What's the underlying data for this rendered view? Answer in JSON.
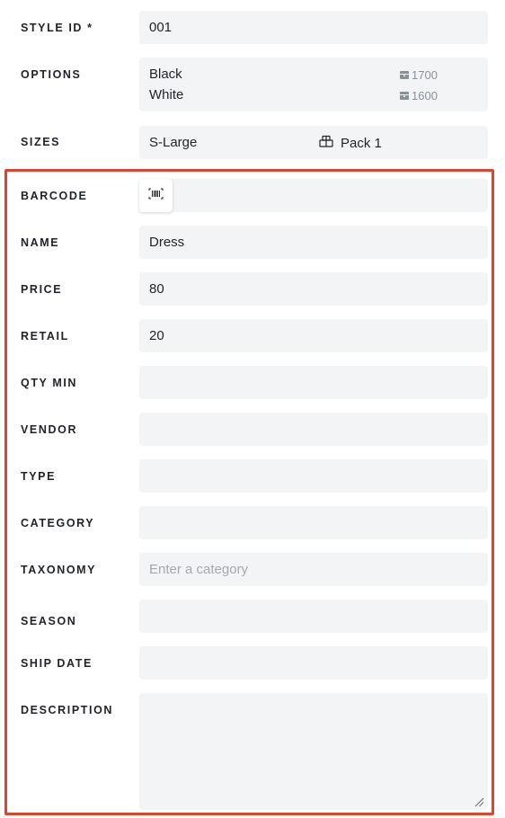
{
  "form": {
    "style_id": {
      "label": "STYLE ID *",
      "value": "001"
    },
    "options": {
      "label": "OPTIONS",
      "items": [
        {
          "name": "Black",
          "qty": "1700"
        },
        {
          "name": "White",
          "qty": "1600"
        }
      ]
    },
    "sizes": {
      "label": "SIZES",
      "value": "S-Large",
      "pack": "Pack 1"
    },
    "barcode": {
      "label": "BARCODE",
      "value": ""
    },
    "name": {
      "label": "NAME",
      "value": "Dress"
    },
    "price": {
      "label": "PRICE",
      "value": "80"
    },
    "retail": {
      "label": "RETAIL",
      "value": "20"
    },
    "qty_min": {
      "label": "QTY MIN",
      "value": ""
    },
    "vendor": {
      "label": "VENDOR",
      "value": ""
    },
    "type": {
      "label": "TYPE",
      "value": ""
    },
    "category": {
      "label": "CATEGORY",
      "value": ""
    },
    "taxonomy": {
      "label": "TAXONOMY",
      "value": "",
      "placeholder": "Enter a category"
    },
    "season": {
      "label": "SEASON",
      "value": ""
    },
    "ship_date": {
      "label": "SHIP DATE",
      "value": ""
    },
    "description": {
      "label": "DESCRIPTION",
      "value": ""
    }
  },
  "colors": {
    "highlight": "#e0442b",
    "field_bg": "#f3f4f6"
  },
  "icons": {
    "barcode": "barcode-icon",
    "qty": "box-icon",
    "pack": "package-icon",
    "resize": "resize-handle-icon"
  }
}
